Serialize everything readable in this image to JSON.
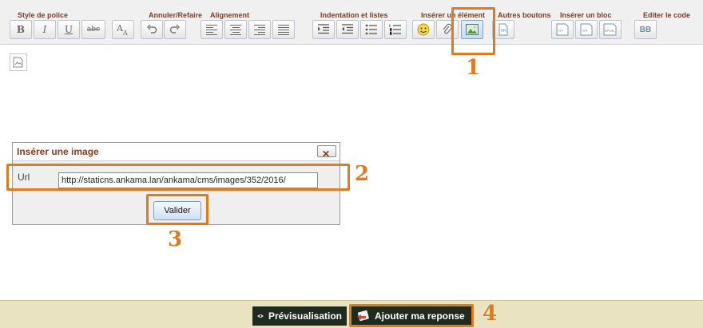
{
  "toolbar": {
    "groups": {
      "style": "Style de police",
      "undo": "Annuler/Refaire",
      "align": "Alignement",
      "indent": "Indentation et listes",
      "insert": "Insérer un élément",
      "other": "Autres boutons",
      "block": "Insérer un bloc",
      "code": "Editer le code"
    },
    "buttons": {
      "bold": "B",
      "italic": "I",
      "underline": "U",
      "strike": "abc",
      "bbcode": "BB"
    }
  },
  "dialog": {
    "title": "Insérer une image",
    "close": "✕",
    "url_label": "Url",
    "url_value": "http://staticns.ankama.lan/ankama/cms/images/352/2016/",
    "submit": "Valider"
  },
  "annotations": [
    "1",
    "2",
    "3",
    "4"
  ],
  "footer": {
    "preview": "Prévisualisation",
    "submit": "Ajouter ma reponse"
  },
  "colors": {
    "annotation": "#e07a1e",
    "group_label": "#8a3a1a",
    "footer_bg": "#e9e3c1",
    "footer_button": "#1f2b1e"
  }
}
